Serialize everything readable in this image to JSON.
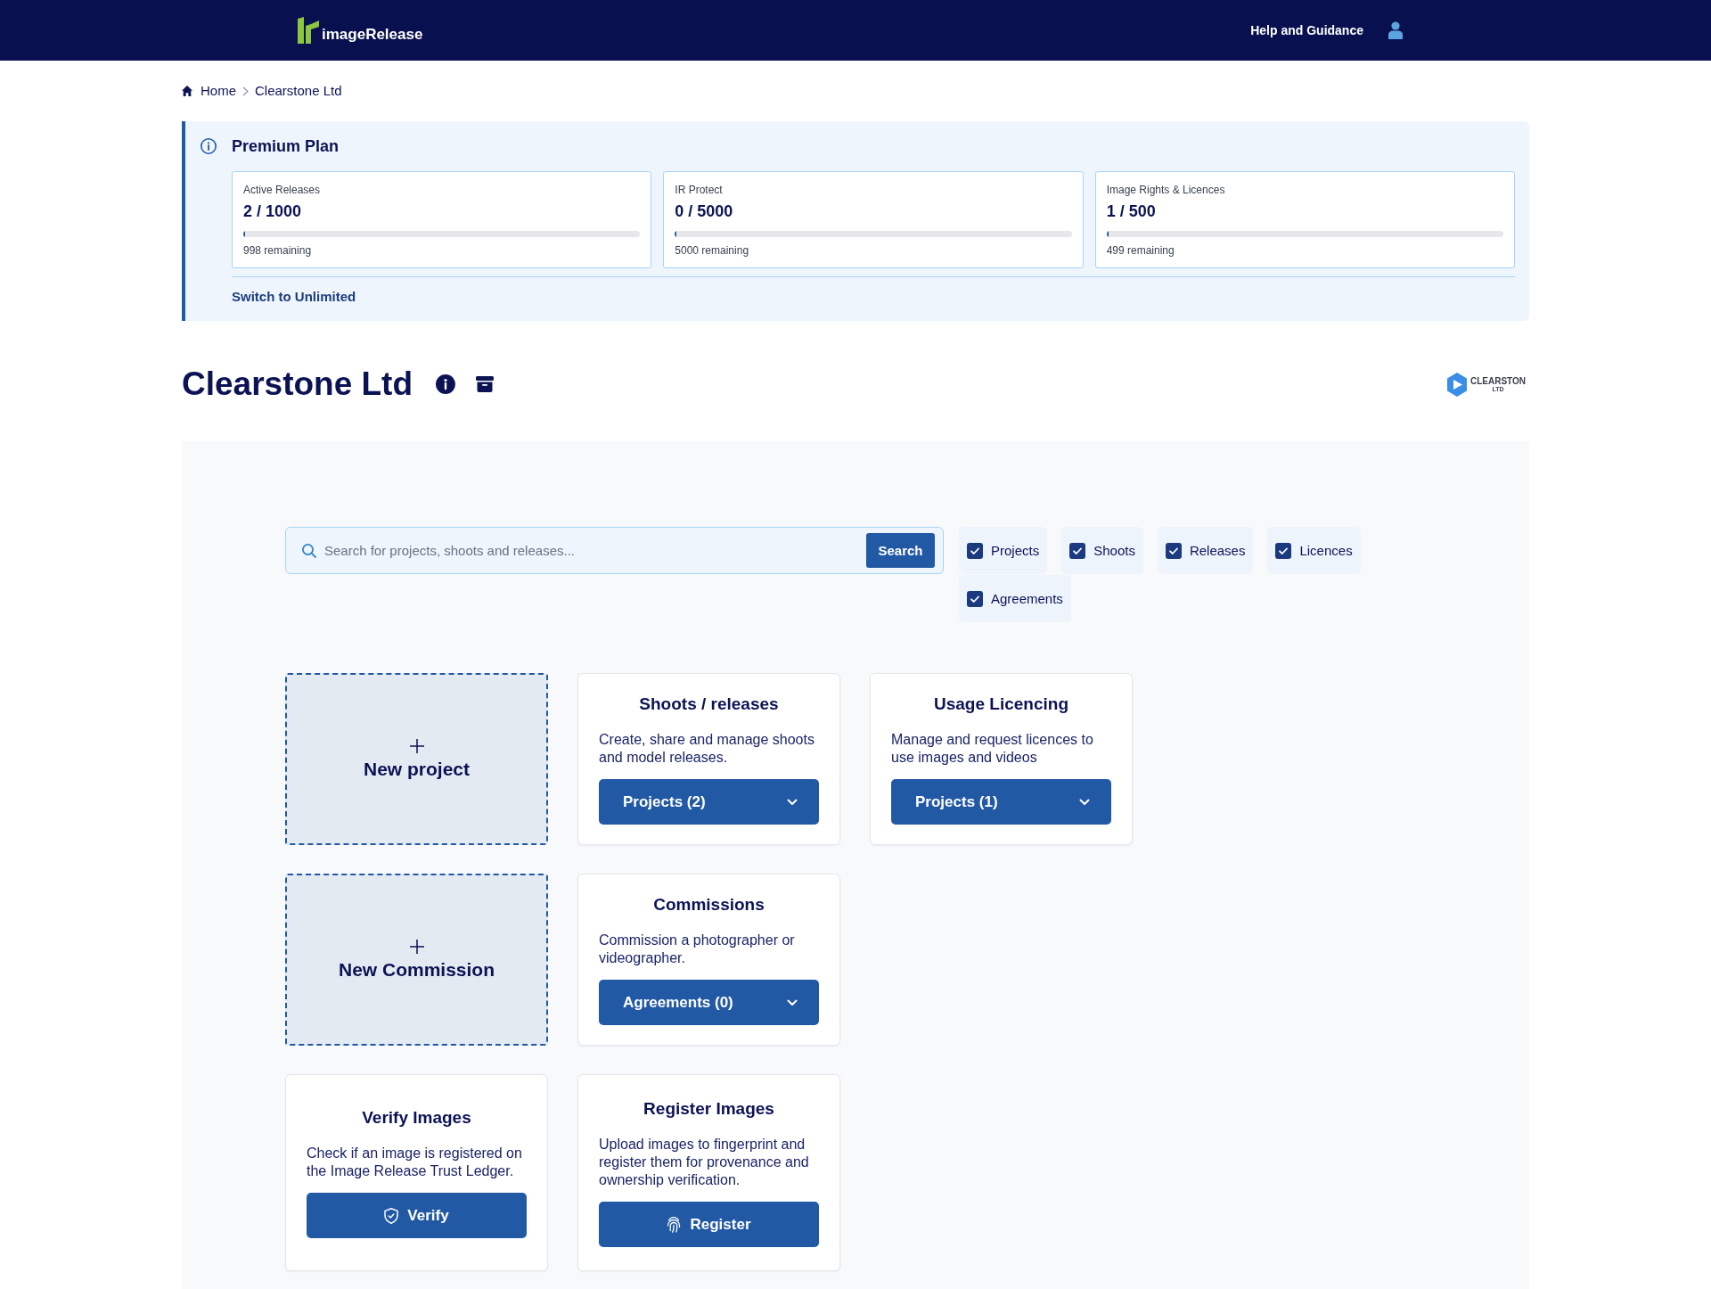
{
  "header": {
    "logo_text": "imageRelease",
    "help_link": "Help and Guidance"
  },
  "breadcrumb": [
    {
      "label": "Home",
      "kind": "home"
    },
    {
      "label": "Clearstone Ltd",
      "kind": "current"
    }
  ],
  "plan": {
    "title": "Premium Plan",
    "usage": [
      {
        "label": "Active Releases",
        "value": "2 / 1000",
        "level": 0.002,
        "remaining": "998 remaining"
      },
      {
        "label": "IR Protect",
        "value": "0 / 5000",
        "level": 0,
        "remaining": "5000 remaining"
      },
      {
        "label": "Image Rights & Licences",
        "value": "1 / 500",
        "level": 0.002,
        "remaining": "499 remaining"
      }
    ],
    "link": "Switch to Unlimited"
  },
  "company": {
    "name": "Clearstone Ltd",
    "logo": {
      "wordmark": "CLEARSTON",
      "suffix": "LTD"
    }
  },
  "search": {
    "placeholder": "Search for projects, shoots and releases...",
    "button": "Search"
  },
  "filters": [
    {
      "label": "Projects",
      "checked": true
    },
    {
      "label": "Shoots",
      "checked": true
    },
    {
      "label": "Releases",
      "checked": true
    },
    {
      "label": "Licences",
      "checked": true
    },
    {
      "label": "Agreements",
      "checked": true
    }
  ],
  "card_rows": [
    [
      {
        "kind": "create",
        "label": "New project"
      },
      {
        "kind": "feature",
        "title": "Shoots / releases",
        "description": "Create, share and manage shoots and model releases.",
        "button": {
          "kind": "dropdown",
          "label": "Projects (2)"
        }
      },
      {
        "kind": "feature",
        "title": "Usage Licencing",
        "description": "Manage and request licences to use images and videos",
        "button": {
          "kind": "dropdown",
          "label": "Projects (1)"
        }
      }
    ],
    [
      {
        "kind": "create",
        "label": "New Commission"
      },
      {
        "kind": "feature",
        "title": "Commissions",
        "description": "Commission a photographer or videographer.",
        "button": {
          "kind": "dropdown",
          "label": "Agreements (0)"
        }
      }
    ],
    [
      {
        "kind": "feature",
        "title": "Verify Images",
        "description": "Check if an image is registered on the Image Release Trust Ledger.",
        "button": {
          "kind": "verify",
          "label": "Verify"
        }
      },
      {
        "kind": "feature",
        "title": "Register Images",
        "description": "Upload images to fingerprint and register them for provenance and ownership verification.",
        "button": {
          "kind": "register",
          "label": "Register"
        }
      }
    ]
  ]
}
